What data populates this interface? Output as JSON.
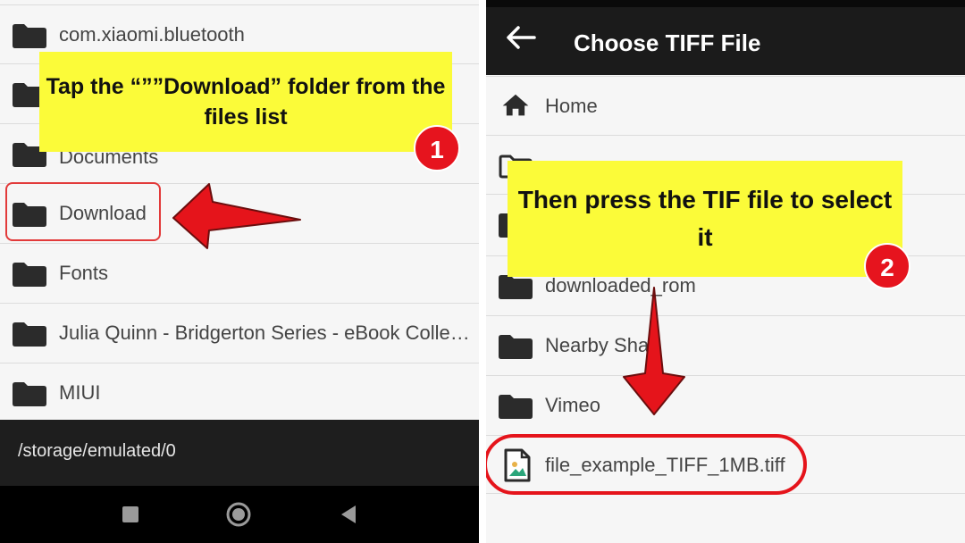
{
  "left": {
    "rows": [
      {
        "label": "com.xiaomi.bluetooth"
      },
      {
        "label": ""
      },
      {
        "label": "Documents"
      },
      {
        "label": "Download"
      },
      {
        "label": "Fonts"
      },
      {
        "label": "Julia Quinn - Bridgerton Series - eBook Collecti..."
      },
      {
        "label": "MIUI"
      }
    ],
    "path": "/storage/emulated/0",
    "callout": "Tap the “””Download” folder from the files list",
    "step": "1"
  },
  "right": {
    "title": "Choose TIFF File",
    "rows": [
      {
        "label": "Home",
        "icon": "home-icon"
      },
      {
        "label": "",
        "icon": "folder-outline-icon"
      },
      {
        "label": "",
        "icon": "folder-icon"
      },
      {
        "label": "downloaded_rom",
        "icon": "folder-icon"
      },
      {
        "label": "Nearby Sha",
        "icon": "folder-icon"
      },
      {
        "label": "Vimeo",
        "icon": "folder-icon"
      },
      {
        "label": "file_example_TIFF_1MB.tiff",
        "icon": "image-file-icon"
      }
    ],
    "callout": "Then press the TIF file to select it",
    "step": "2"
  },
  "colors": {
    "callout_bg": "#fbfb39",
    "badge_bg": "#e6141e",
    "arrow": "#e5141b",
    "bar_dark": "#1e1e1e"
  }
}
